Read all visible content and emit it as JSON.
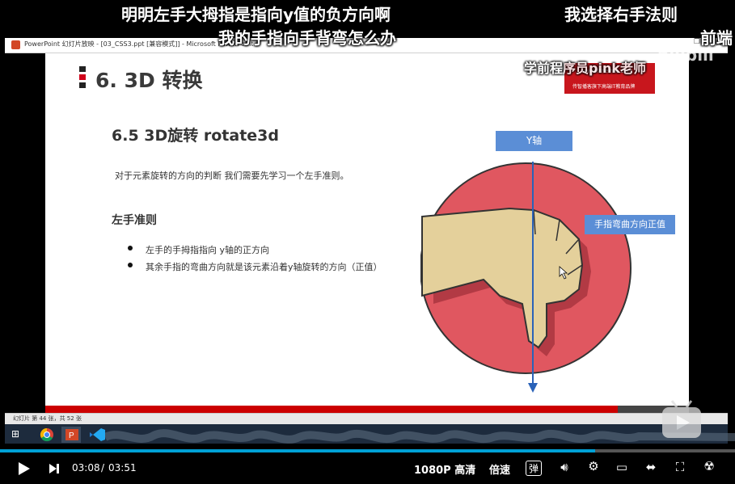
{
  "danmaku": [
    "明明左手大拇指是指向y值的负方向啊",
    "我选择右手法则",
    "我的手指向手背弯怎么办",
    "前端",
    "学前程序员pink老师"
  ],
  "ppt_window": {
    "title": "PowerPoint 幻灯片放映 - [03_CSS3.ppt [兼容模式]] - Microsoft PowerPoint",
    "restore_icon": "restore-icon",
    "close_icon": "close-icon"
  },
  "slide": {
    "section_title": "6. 3D 转换",
    "logo_line1": "传智播客旗下高端IT教育品牌",
    "logo_url": "www.itheima.com",
    "sub_title": "6.5 3D旋转 rotate3d",
    "intro": "对于元素旋转的方向的判断 我们需要先学习一个左手准则。",
    "rule_title": "左手准则",
    "bullets": [
      "左手的手拇指指向 y轴的正方向",
      "其余手指的弯曲方向就是该元素沿着y轴旋转的方向（正值）"
    ],
    "y_axis_label": "Y轴",
    "finger_label": "手指弯曲方向正值",
    "colors": {
      "circle": "#e05760",
      "hand": "#e4d09b",
      "label_blue": "#5b8ed6",
      "accent_red": "#c8161d"
    }
  },
  "ppt_status": {
    "text": "幻灯片 第 44 张，共 52 张"
  },
  "taskbar": {
    "apps": [
      "windows-start-icon",
      "chrome-icon",
      "powerpoint-icon",
      "vscode-icon"
    ]
  },
  "player": {
    "current_time": "03:08",
    "separator": "/",
    "total_time": "03:51",
    "progress": 0.81,
    "quality": "1080P 高清",
    "speed": "倍速",
    "danmaku_toggle": "弹",
    "watermark": "bilibili"
  }
}
